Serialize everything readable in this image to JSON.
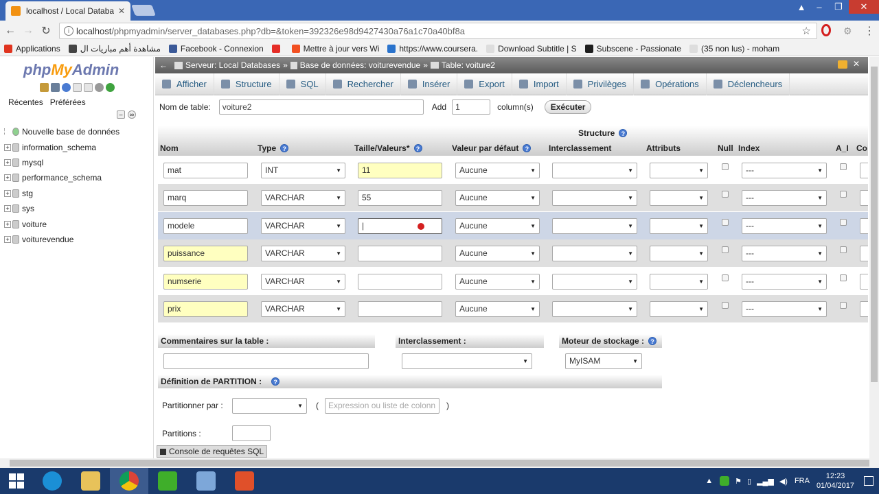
{
  "browser": {
    "tab_title": "localhost / Local Databa",
    "url_host": "localhost",
    "url_rest": "/phpmyadmin/server_databases.php?db=&token=392326e98d9427430a76a1c70a40bf8a",
    "bookmarks": [
      {
        "label": "Applications",
        "icon": "apps-grid-icon",
        "color": "#e0341f"
      },
      {
        "label": "مشاهدة أهم مباريات ال",
        "icon": "site-icon",
        "color": "#444444"
      },
      {
        "label": "Facebook - Connexion",
        "icon": "facebook-icon",
        "color": "#3b5998"
      },
      {
        "label": "",
        "icon": "youtube-icon",
        "color": "#e52d27"
      },
      {
        "label": "Mettre à jour vers Wi",
        "icon": "windows-icon",
        "color": "#f25022"
      },
      {
        "label": "https://www.coursera.",
        "icon": "coursera-icon",
        "color": "#2a73cc"
      },
      {
        "label": "Download Subtitle | S",
        "icon": "page-icon",
        "color": "#dddddd"
      },
      {
        "label": "Subscene - Passionate",
        "icon": "subscene-icon",
        "color": "#1e1e1e"
      },
      {
        "label": "(35 non lus) - moham",
        "icon": "page-icon",
        "color": "#dddddd"
      }
    ]
  },
  "sidebar": {
    "logo_php": "php",
    "logo_my": "My",
    "logo_admin": "Admin",
    "links": [
      "Récentes",
      "Préférées"
    ],
    "databases": [
      {
        "name": "Nouvelle base de données",
        "expandable": false
      },
      {
        "name": "information_schema",
        "expandable": true
      },
      {
        "name": "mysql",
        "expandable": true
      },
      {
        "name": "performance_schema",
        "expandable": true
      },
      {
        "name": "stg",
        "expandable": true
      },
      {
        "name": "sys",
        "expandable": true
      },
      {
        "name": "voiture",
        "expandable": true
      },
      {
        "name": "voiturevendue",
        "expandable": true
      }
    ]
  },
  "breadcrumb": {
    "server": "Serveur: Local Databases",
    "db": "Base de données: voiturevendue",
    "table": "Table: voiture2",
    "sep": "»"
  },
  "menu": [
    "Afficher",
    "Structure",
    "SQL",
    "Rechercher",
    "Insérer",
    "Export",
    "Import",
    "Privilèges",
    "Opérations",
    "Déclencheurs"
  ],
  "form": {
    "table_name_label": "Nom de table:",
    "table_name_value": "voiture2",
    "add_label": "Add",
    "add_value": "1",
    "columns_label": "column(s)",
    "execute_label": "Exécuter",
    "structure_label": "Structure",
    "headers": [
      "Nom",
      "Type",
      "Taille/Valeurs*",
      "Valeur par défaut",
      "Interclassement",
      "Attributs",
      "Null",
      "Index",
      "A_I",
      "Co"
    ]
  },
  "columns": [
    {
      "name": "mat",
      "type": "INT",
      "size": "11",
      "default": "Aucune",
      "index": "---",
      "name_hl": false,
      "size_hl": true
    },
    {
      "name": "marq",
      "type": "VARCHAR",
      "size": "55",
      "default": "Aucune",
      "index": "---",
      "name_hl": false,
      "size_hl": false
    },
    {
      "name": "modele",
      "type": "VARCHAR",
      "size": "|",
      "default": "Aucune",
      "index": "---",
      "name_hl": false,
      "size_hl": false
    },
    {
      "name": "puissance",
      "type": "VARCHAR",
      "size": "",
      "default": "Aucune",
      "index": "---",
      "name_hl": true,
      "size_hl": false
    },
    {
      "name": "numserie",
      "type": "VARCHAR",
      "size": "",
      "default": "Aucune",
      "index": "---",
      "name_hl": true,
      "size_hl": false
    },
    {
      "name": "prix",
      "type": "VARCHAR",
      "size": "",
      "default": "Aucune",
      "index": "---",
      "name_hl": true,
      "size_hl": false
    }
  ],
  "table_options": {
    "comments_label": "Commentaires sur la table :",
    "collation_label": "Interclassement :",
    "engine_label": "Moteur de stockage :",
    "engine_value": "MyISAM"
  },
  "partition": {
    "heading": "Définition de PARTITION :",
    "by_label": "Partitionner par :",
    "expr_placeholder": "Expression ou liste de colonn",
    "paren_open": "(",
    "paren_close": ")",
    "partitions_label": "Partitions :"
  },
  "console_label": "Console de requêtes SQL",
  "taskbar": {
    "lang": "FRA",
    "time": "12:23",
    "date": "01/04/2017"
  }
}
